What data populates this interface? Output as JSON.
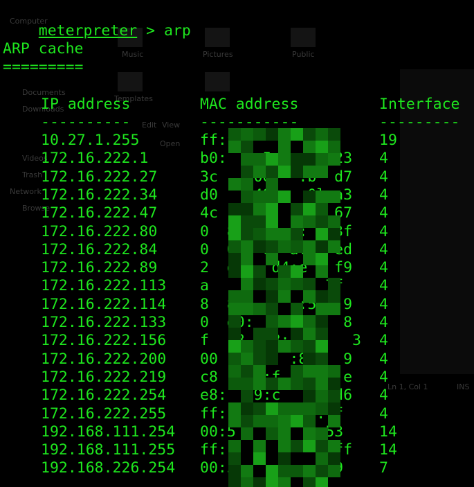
{
  "terminal": {
    "command_prompt": "meterpreter",
    "command_text": " > arp",
    "cache_title": "ARP cache",
    "cache_underline": "=========",
    "headers": {
      "ip": "IP address",
      "mac": "MAC address",
      "iface": "Interface"
    },
    "header_rules": {
      "ip": "----------",
      "mac": "-----------",
      "iface": "---------"
    },
    "rows": [
      {
        "ip": "10.27.1.255",
        "mac": "ff:f         ff",
        "iface": "19"
      },
      {
        "ip": "172.16.222.1",
        "mac": "b0:   :5  a:4  23",
        "iface": "4"
      },
      {
        "ip": "172.16.222.27",
        "mac": "3c   :0e.  :b  d7",
        "iface": "4"
      },
      {
        "ip": "172.16.222.34",
        "mac": "d0   :49:   0l a3",
        "iface": "4"
      },
      {
        "ip": "172.16.222.47",
        "mac": "4c   :75:    e 67",
        "iface": "4"
      },
      {
        "ip": "172.16.222.80",
        "mac": "0  8  ff:  :   3f",
        "iface": "4"
      },
      {
        "ip": "172.16.222.84",
        "mac": "0  0e  6  a:5  ed",
        "iface": "4"
      },
      {
        "ip": "172.16.222.89",
        "mac": "2  d2:  d4:e   f9",
        "iface": "4"
      },
      {
        "ip": "172.16.222.113",
        "mac": "a    :  98    7f",
        "iface": "4"
      },
      {
        "ip": "172.16.222.114",
        "mac": "8  85      :5d  9",
        "iface": "4"
      },
      {
        "ip": "172.16.222.133",
        "mac": "0  e0:      3   8",
        "iface": "4"
      },
      {
        "ip": "172.16.222.156",
        "mac": "f  18   8:  :b   3",
        "iface": "4"
      },
      {
        "ip": "172.16.222.200",
        "mac": "00   2:9  :85   9",
        "iface": "4"
      },
      {
        "ip": "172.16.222.219",
        "mac": "c8   76:f   78  e",
        "iface": "4"
      },
      {
        "ip": "172.16.222.254",
        "mac": "e8:  19:c   5  d6",
        "iface": "4"
      },
      {
        "ip": "172.16.222.255",
        "mac": "ff:          :ff",
        "iface": "4"
      },
      {
        "ip": "192.168.111.254",
        "mac": "00:5         :53",
        "iface": "14"
      },
      {
        "ip": "192.168.111.255",
        "mac": "ff:          f:ff",
        "iface": "14"
      },
      {
        "ip": "192.168.226.254",
        "mac": "00:5         :19",
        "iface": "7"
      }
    ]
  },
  "background": {
    "items": [
      "Computer",
      "Music",
      "Pictures",
      "Public",
      "Documents",
      "Downloads",
      "Templates",
      "Network",
      "Browse",
      "Edit",
      "View",
      "Open",
      "Trash",
      "Videos"
    ],
    "status": "Ln 1, Col 1",
    "ins": "INS"
  },
  "colors": {
    "terminal_bg": "#000000",
    "terminal_text": "#1ee61e",
    "censor_green": "#0f6a0f"
  }
}
